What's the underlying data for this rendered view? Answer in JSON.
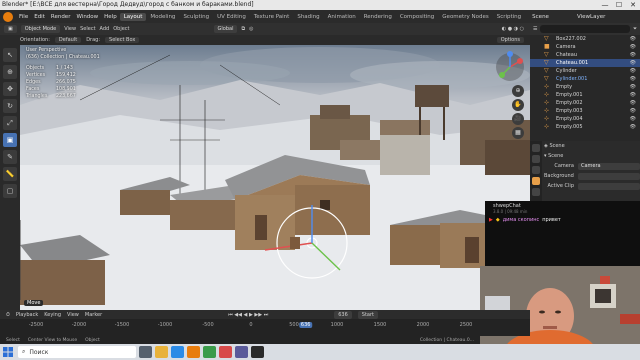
{
  "window": {
    "title": "Blender* [E:\\ВСЕ для вестерна\\Город Дедвуд\\город с банком и бараками.blend]",
    "controls": [
      "—",
      "☐",
      "✕"
    ]
  },
  "menubar": {
    "menus": [
      "File",
      "Edit",
      "Render",
      "Window",
      "Help"
    ],
    "workspaces": [
      "Layout",
      "Modeling",
      "Sculpting",
      "UV Editing",
      "Texture Paint",
      "Shading",
      "Animation",
      "Rendering",
      "Compositing",
      "Geometry Nodes",
      "Scripting"
    ],
    "active_workspace": "Layout",
    "scene_label": "Scene",
    "view_layer_label": "ViewLayer"
  },
  "header": {
    "mode": "Object Mode",
    "menus": [
      "View",
      "Select",
      "Add",
      "Object"
    ],
    "transform_orientation": "Global"
  },
  "toolbar2": {
    "orientation_label": "Orientation:",
    "orientation_value": "Default",
    "drag_label": "Drag:",
    "drag_value": "Select Box",
    "options_label": "Options"
  },
  "viewport": {
    "view_name": "User Perspective",
    "collection": "(636) Collection | Chateau.001",
    "stats": [
      {
        "label": "Objects",
        "value": "1 / 143"
      },
      {
        "label": "Vertices",
        "value": "159,412"
      },
      {
        "label": "Edges",
        "value": "266,075"
      },
      {
        "label": "Faces",
        "value": "108,901"
      },
      {
        "label": "Triangles",
        "value": "223,667"
      }
    ],
    "move_label": "Move"
  },
  "outliner": {
    "search_placeholder": "",
    "items": [
      {
        "name": "Box227.002",
        "icon": "mesh-icon"
      },
      {
        "name": "Camera",
        "icon": "camera-icon"
      },
      {
        "name": "Chateau",
        "icon": "mesh-icon"
      },
      {
        "name": "Chateau.001",
        "icon": "mesh-icon"
      },
      {
        "name": "Cylinder",
        "icon": "mesh-icon"
      },
      {
        "name": "Cylinder.001",
        "icon": "mesh-icon"
      },
      {
        "name": "Empty",
        "icon": "empty-icon"
      },
      {
        "name": "Empty.001",
        "icon": "empty-icon"
      },
      {
        "name": "Empty.002",
        "icon": "empty-icon"
      },
      {
        "name": "Empty.003",
        "icon": "empty-icon"
      },
      {
        "name": "Empty.004",
        "icon": "empty-icon"
      },
      {
        "name": "Empty.005",
        "icon": "empty-icon"
      }
    ],
    "selected_index": 3,
    "highlight_index": 5
  },
  "properties": {
    "breadcrumb": "Scene",
    "section": "Scene",
    "camera_label": "Camera",
    "camera_value": "Camera",
    "background_label": "Background ...",
    "active_clip_label": "Active Clip"
  },
  "chat": {
    "title": "shwepChat",
    "subtitle": "3.8.0 | 09:48 min",
    "user": "дима скопинс",
    "text": "привет"
  },
  "timeline": {
    "menus": [
      "Playback",
      "Keying",
      "View",
      "Marker"
    ],
    "ticks": [
      "-2500",
      "-2000",
      "-1500",
      "-1000",
      "-500",
      "0",
      "500",
      "1000",
      "1500",
      "2000",
      "2500"
    ],
    "current_frame": "636",
    "start_label": "Start"
  },
  "statusbar": {
    "items": [
      "Select",
      "Center View to Mouse",
      "Object"
    ],
    "right": "Collection | Chateau.0..."
  },
  "taskbar": {
    "search_label": "Поиск"
  },
  "colors": {
    "accent": "#4772b3",
    "object_orange": "#e8a04a",
    "chat_user": "#e58ff0"
  }
}
